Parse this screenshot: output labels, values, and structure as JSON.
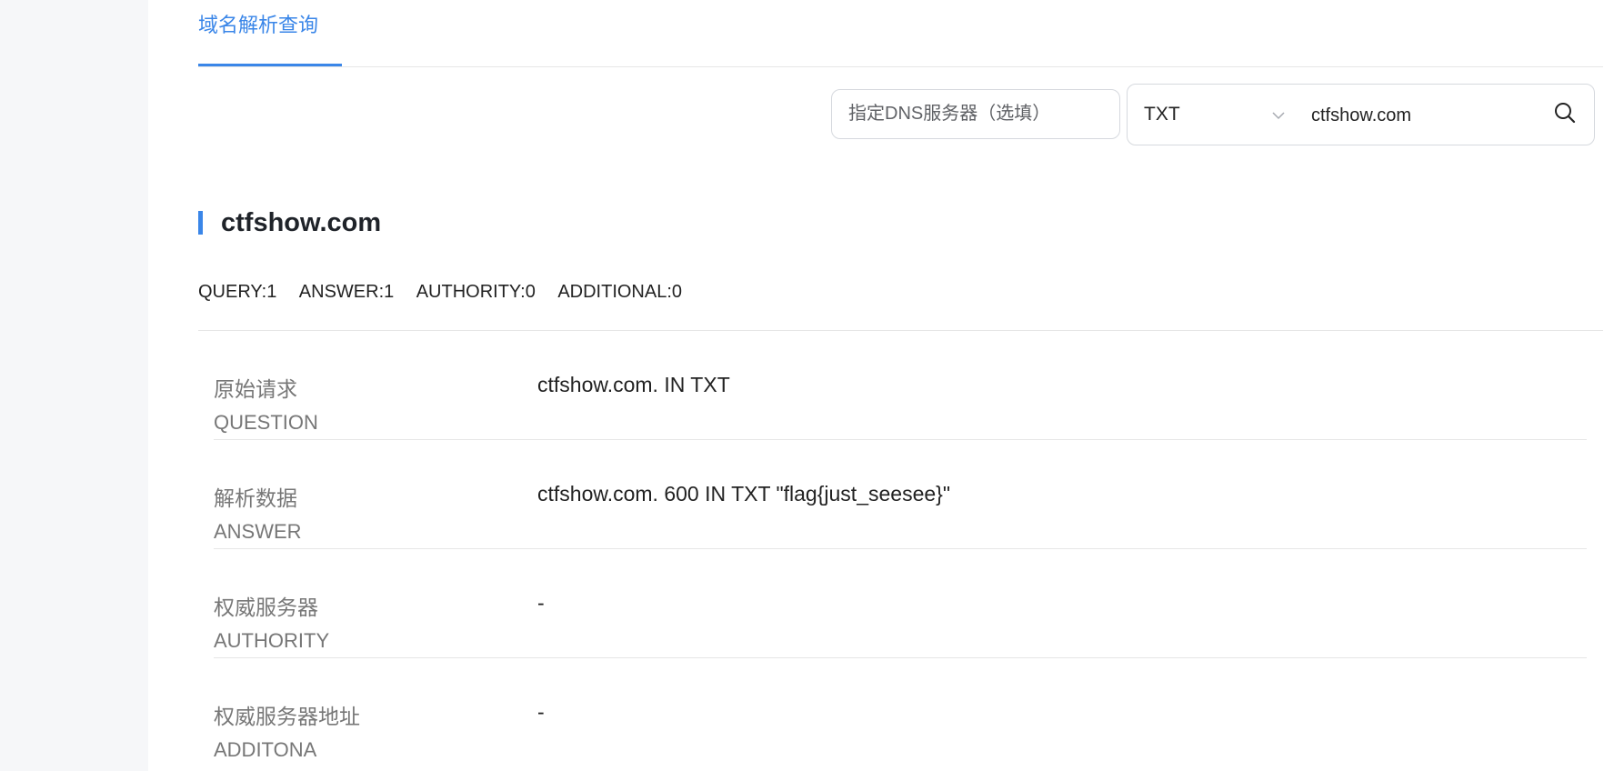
{
  "tabs": {
    "active_label": "域名解析查询"
  },
  "query": {
    "dns_server_placeholder": "指定DNS服务器（选填）",
    "record_type": "TXT",
    "domain_value": "ctfshow.com"
  },
  "result": {
    "domain": "ctfshow.com",
    "stats": {
      "query": "QUERY:1",
      "answer": "ANSWER:1",
      "authority": "AUTHORITY:0",
      "additional": "ADDITIONAL:0"
    },
    "records": [
      {
        "label_zh": "原始请求",
        "label_en": "QUESTION",
        "value": "ctfshow.com. IN TXT"
      },
      {
        "label_zh": "解析数据",
        "label_en": "ANSWER",
        "value": "ctfshow.com. 600 IN TXT \"flag{just_seesee}\""
      },
      {
        "label_zh": "权威服务器",
        "label_en": "AUTHORITY",
        "value": "-"
      },
      {
        "label_zh": "权威服务器地址",
        "label_en": "ADDITONA",
        "value": "-"
      }
    ]
  },
  "colors": {
    "accent": "#3a86e8",
    "divider": "#e6e6e6",
    "label": "#777777"
  },
  "icons": {
    "search": "search-icon",
    "dropdown": "chevron-down-icon"
  }
}
